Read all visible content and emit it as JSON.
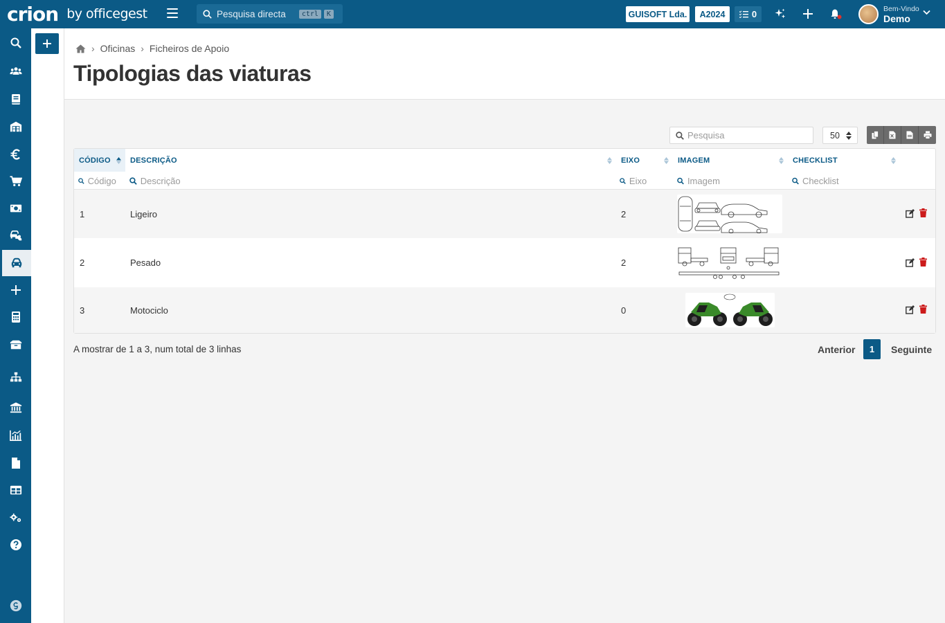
{
  "app": {
    "logo_main": "crion",
    "logo_sub": "by officegest",
    "search_placeholder": "Pesquisa directa",
    "search_kbd_1": "ctrl",
    "search_kbd_2": "K",
    "company": "GUISOFT Lda.",
    "year": "A2024",
    "tasks_count": "0",
    "welcome": "Bem-Vindo",
    "user_name": "Demo",
    "accent": "#0b5a86",
    "danger": "#cc1b1b"
  },
  "breadcrumb": {
    "items": [
      "Oficinas",
      "Ficheiros de Apoio"
    ]
  },
  "page": {
    "title": "Tipologias das viaturas"
  },
  "toolbar": {
    "search_placeholder": "Pesquisa",
    "page_size": "50"
  },
  "table": {
    "headers": {
      "codigo": "CÓDIGO",
      "descricao": "DESCRIÇÃO",
      "eixo": "EIXO",
      "imagem": "IMAGEM",
      "checklist": "CHECKLIST"
    },
    "filters": {
      "codigo": "Código",
      "descricao": "Descrição",
      "eixo": "Eixo",
      "imagem": "Imagem",
      "checklist": "Checklist"
    },
    "rows": [
      {
        "codigo": "1",
        "descricao": "Ligeiro",
        "eixo": "2",
        "imagem": "car-diagram",
        "checklist": ""
      },
      {
        "codigo": "2",
        "descricao": "Pesado",
        "eixo": "2",
        "imagem": "truck-diagram",
        "checklist": ""
      },
      {
        "codigo": "3",
        "descricao": "Motociclo",
        "eixo": "0",
        "imagem": "motorcycle-diagram",
        "checklist": ""
      }
    ]
  },
  "pagination": {
    "info": "A mostrar de 1 a 3, num total de 3 linhas",
    "prev": "Anterior",
    "current": "1",
    "next": "Seguinte"
  },
  "sidebar": {
    "icons": [
      "search-icon",
      "users-icon",
      "book-icon",
      "warehouse-icon",
      "euro-icon",
      "cart-icon",
      "money-icon",
      "car-wrench-icon",
      "car-icon",
      "plus-icon",
      "calculator-icon",
      "box-icon",
      "sitemap-icon",
      "bank-icon",
      "chart-icon",
      "file-icon",
      "table-icon",
      "cogs-icon",
      "help-icon",
      "officegest-icon"
    ]
  }
}
